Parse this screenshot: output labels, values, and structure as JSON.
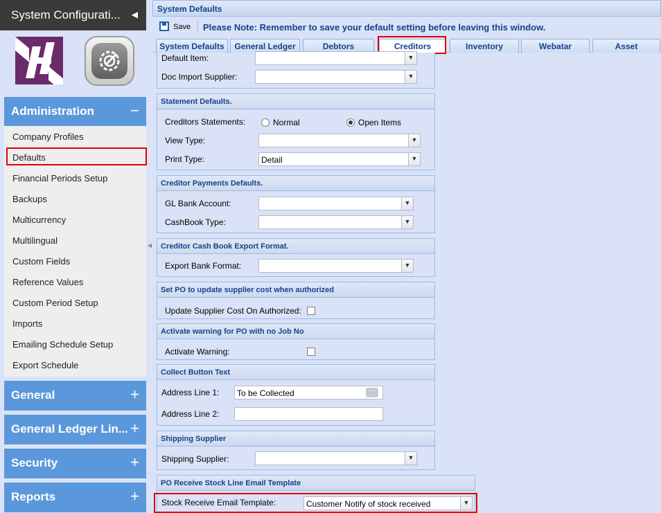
{
  "sidebar": {
    "title": "System Configurati...",
    "administration": {
      "label": "Administration",
      "sign": "−",
      "items": [
        {
          "label": "Company Profiles"
        },
        {
          "label": "Defaults"
        },
        {
          "label": "Financial Periods Setup"
        },
        {
          "label": "Backups"
        },
        {
          "label": "Multicurrency"
        },
        {
          "label": "Multilingual"
        },
        {
          "label": "Custom Fields"
        },
        {
          "label": "Reference Values"
        },
        {
          "label": "Custom Period Setup"
        },
        {
          "label": "Imports"
        },
        {
          "label": "Emailing Schedule Setup"
        },
        {
          "label": "Export Schedule"
        }
      ]
    },
    "groups": [
      {
        "label": "General",
        "sign": "+"
      },
      {
        "label": "General Ledger Lin...",
        "sign": "+"
      },
      {
        "label": "Security",
        "sign": "+"
      },
      {
        "label": "Reports",
        "sign": "+"
      }
    ]
  },
  "main": {
    "title": "System Defaults",
    "toolbar": {
      "save_label": "Save",
      "note": "Please Note: Remember to save your default setting before leaving this window."
    },
    "tabs": [
      {
        "label": "System Defaults"
      },
      {
        "label": "General Ledger"
      },
      {
        "label": "Debtors"
      },
      {
        "label": "Creditors",
        "active": true
      },
      {
        "label": "Inventory"
      },
      {
        "label": "Webatar"
      },
      {
        "label": "Asset"
      }
    ],
    "top_fields": {
      "default_item_label": "Default Item:",
      "default_item_value": "",
      "doc_import_label": "Doc Import Supplier:",
      "doc_import_value": ""
    },
    "statement": {
      "title": "Statement Defaults.",
      "creditors_statements_label": "Creditors Statements:",
      "radio_normal": "Normal",
      "radio_open": "Open Items",
      "selected": "Open Items",
      "view_type_label": "View Type:",
      "view_type_value": "",
      "print_type_label": "Print Type:",
      "print_type_value": "Detail"
    },
    "payments": {
      "title": "Creditor Payments Defaults.",
      "gl_bank_label": "GL Bank Account:",
      "gl_bank_value": "",
      "cashbook_label": "CashBook Type:",
      "cashbook_value": ""
    },
    "export": {
      "title": "Creditor Cash Book Export Format.",
      "bank_format_label": "Export Bank Format:",
      "bank_format_value": ""
    },
    "po_cost": {
      "title": "Set PO to update supplier cost when authorized",
      "label": "Update Supplier Cost On Authorized:",
      "checked": false
    },
    "po_warning": {
      "title": "Activate warning for PO with no Job No",
      "label": "Activate Warning:",
      "checked": false
    },
    "collect": {
      "title": "Collect Button Text",
      "addr1_label": "Address Line 1:",
      "addr1_value": "To be Collected",
      "addr2_label": "Address Line 2:",
      "addr2_value": ""
    },
    "shipping": {
      "title": "Shipping Supplier",
      "label": "Shipping Supplier:",
      "value": ""
    },
    "po_receive": {
      "title": "PO Receive Stock Line Email Template",
      "label": "Stock Receive Email Template:",
      "value": "Customer Notify of stock received"
    }
  }
}
